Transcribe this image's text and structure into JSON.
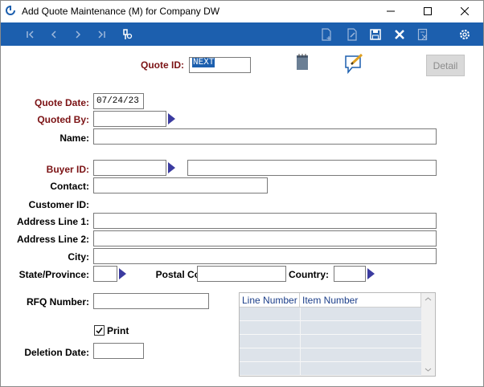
{
  "window": {
    "title": "Add Quote Maintenance (M) for Company DW",
    "controls": [
      "minimize",
      "maximize",
      "close"
    ]
  },
  "toolbar": {
    "left_icons": [
      "first-icon",
      "previous-icon",
      "next-icon",
      "last-icon",
      "lookup-icon"
    ],
    "right_icons": [
      "new-document-icon",
      "edit-document-icon",
      "save-icon",
      "delete-icon",
      "excel-icon",
      "settings-icon"
    ]
  },
  "form": {
    "quote_id": {
      "label": "Quote ID:",
      "value": "NEXT"
    },
    "detail_button": "Detail",
    "quote_date": {
      "label": "Quote Date:",
      "value": "07/24/23"
    },
    "quoted_by": {
      "label": "Quoted By:",
      "value": ""
    },
    "name": {
      "label": "Name:",
      "value": ""
    },
    "buyer_id": {
      "label": "Buyer ID:",
      "value": "",
      "description": ""
    },
    "contact": {
      "label": "Contact:",
      "value": ""
    },
    "customer_id": {
      "label": "Customer ID:"
    },
    "address1": {
      "label": "Address Line 1:",
      "value": ""
    },
    "address2": {
      "label": "Address Line 2:",
      "value": ""
    },
    "city": {
      "label": "City:",
      "value": ""
    },
    "state": {
      "label": "State/Province:",
      "value": ""
    },
    "postal_code": {
      "label": "Postal Code:",
      "value": ""
    },
    "country": {
      "label": "Country:",
      "value": ""
    },
    "rfq_number": {
      "label": "RFQ Number:",
      "value": ""
    },
    "print": {
      "label": "Print",
      "checked": true
    },
    "deletion_date": {
      "label": "Deletion Date:",
      "value": ""
    }
  },
  "grid": {
    "columns": [
      "Line Number",
      "Item Number"
    ],
    "rows": [
      [
        "",
        ""
      ],
      [
        "",
        ""
      ],
      [
        "",
        ""
      ],
      [
        "",
        ""
      ],
      [
        "",
        ""
      ]
    ]
  },
  "colors": {
    "toolbar": "#1c5fae",
    "required_label": "#7b1214",
    "lookup_arrow": "#3b3ba0",
    "grid_header_text": "#1c3f8a"
  }
}
